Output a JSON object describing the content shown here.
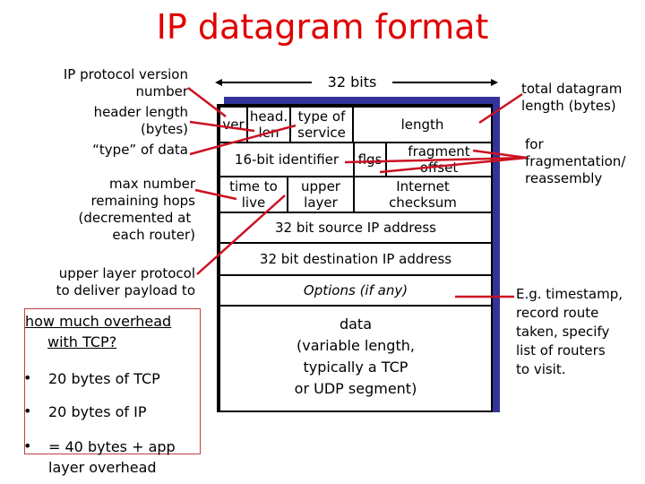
{
  "title": "IP datagram format",
  "colors": {
    "title": "#e00000",
    "pointer_lines": "#cc1122",
    "packet_shadow": "#333399",
    "overhead_box_border": "#c04040"
  },
  "width_label": "32 bits",
  "left_annotations": {
    "version": "IP protocol version\nnumber",
    "header_length": "header length\n(bytes)",
    "type_of_data": "“type” of data",
    "max_hops": "max number\nremaining hops\n(decremented at \neach router)",
    "upper_layer": "upper layer protocol\nto deliver payload to"
  },
  "right_annotations": {
    "total_length": "total datagram\nlength (bytes)",
    "fragmentation": "for\nfragmentation/\nreassembly",
    "options": "E.g. timestamp,\nrecord route\ntaken, specify\nlist of routers\nto visit."
  },
  "fields": {
    "ver": "ver",
    "head_len": "head.\nlen",
    "type_of_service": "type of\nservice",
    "length": "length",
    "identifier": "16-bit identifier",
    "flags": "flgs",
    "fragment_offset": "fragment\noffset",
    "ttl": "time to\nlive",
    "upper_layer": "upper\nlayer",
    "checksum": "Internet\nchecksum",
    "source_ip": "32 bit source IP address",
    "dest_ip": "32 bit destination IP address",
    "options": "Options (if any)",
    "data": "data\n(variable length,\ntypically a TCP\nor UDP segment)"
  },
  "overhead": {
    "heading_line1": "how much overhead",
    "heading_line2": "with TCP?",
    "bullets": [
      "20 bytes of TCP",
      "20 bytes of IP",
      "= 40 bytes + app"
    ],
    "continuation": "layer overhead",
    "bullet_glyph": "•"
  }
}
